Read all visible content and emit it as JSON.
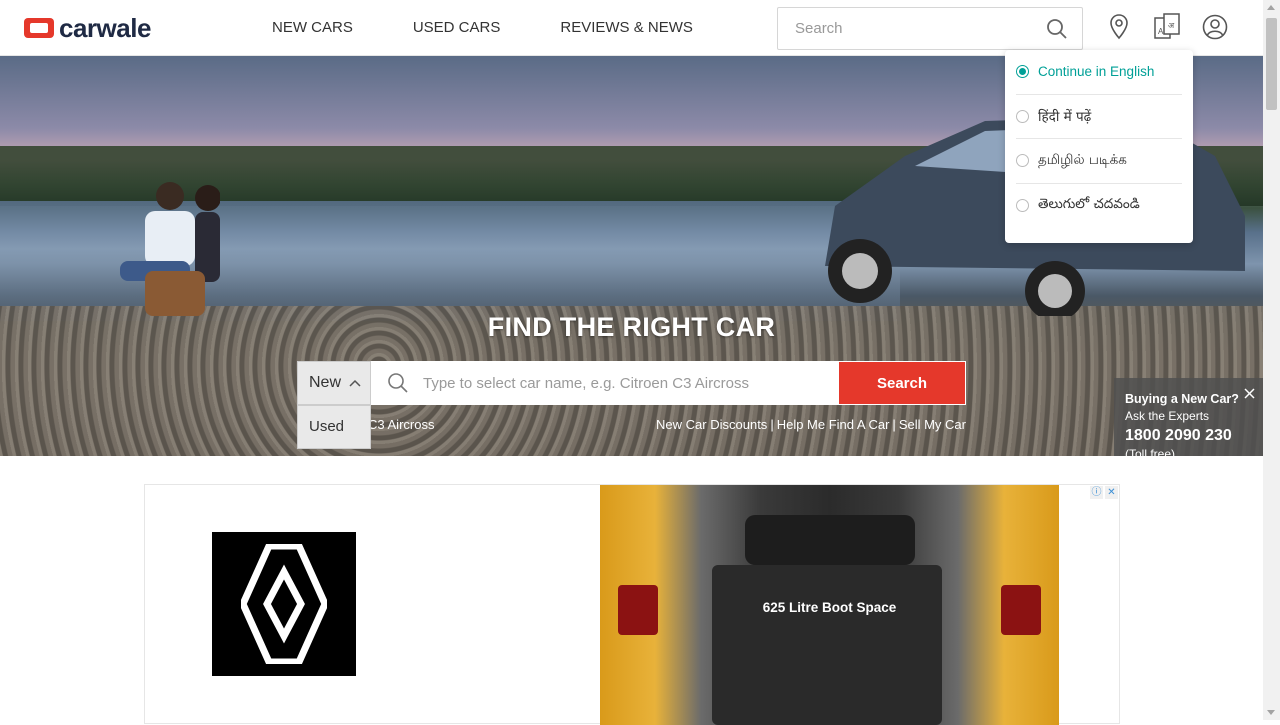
{
  "brand": {
    "name": "carwale",
    "accent": "#e5382b"
  },
  "nav": {
    "items": [
      "NEW CARS",
      "USED CARS",
      "REVIEWS & NEWS"
    ]
  },
  "header_search": {
    "placeholder": "Search"
  },
  "header_icons": [
    "location-icon",
    "language-icon",
    "account-icon"
  ],
  "language_menu": {
    "options": [
      {
        "label": "Continue in English",
        "selected": true
      },
      {
        "label": "हिंदी में पढ़ें",
        "selected": false
      },
      {
        "label": "தமிழில் படிக்க",
        "selected": false
      },
      {
        "label": "తెలుగులో చదవండి",
        "selected": false
      }
    ],
    "accent": "#00a097"
  },
  "hero": {
    "title": "FIND THE RIGHT CAR",
    "type_select": {
      "value": "New",
      "options": [
        "New",
        "Used"
      ]
    },
    "car_search": {
      "placeholder": "Type to select car name, e.g. Citroen C3 Aircross"
    },
    "search_button": "Search",
    "left_link_fragment": "C3 Aircross",
    "links": [
      "New Car Discounts",
      "Help Me Find A Car",
      "Sell My Car"
    ],
    "link_separator": "|"
  },
  "buying_box": {
    "heading": "Buying a New Car?",
    "sub": "Ask the Experts",
    "phone": "1800 2090 230",
    "note": "(Toll free)"
  },
  "ad": {
    "caption": "625 Litre Boot Space",
    "brand_logo": "renault-logo"
  }
}
